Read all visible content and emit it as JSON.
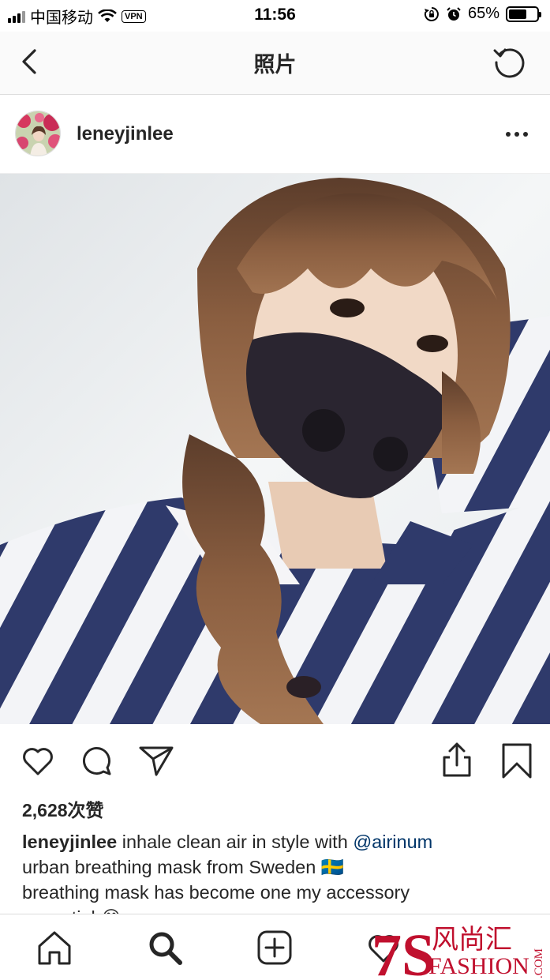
{
  "status_bar": {
    "carrier": "中国移动",
    "vpn": "VPN",
    "time": "11:56",
    "battery": "65%",
    "battery_level": 0.65
  },
  "nav": {
    "title": "照片",
    "back_icon": "chevron-left-icon",
    "refresh_icon": "refresh-icon"
  },
  "post": {
    "username": "leneyjinlee",
    "more_icon": "more-horizontal-icon",
    "likes": "2,628次赞",
    "caption": {
      "username": "leneyjinlee",
      "text_before_mention": " inhale clean air in style with ",
      "mention": "@airinum",
      "line2": "urban breathing mask from Sweden 🇸🇪",
      "line3": "breathing mask has become one my accessory",
      "line4": "essential 😂"
    }
  },
  "actions": [
    "heart-icon",
    "comment-icon",
    "share-direct-icon",
    "upload-icon",
    "bookmark-icon"
  ],
  "tabs": [
    "home-icon",
    "search-icon",
    "add-post-icon",
    "activity-heart-icon"
  ],
  "watermark": {
    "number": "7S",
    "cn": "风尚汇",
    "en": "FASHION",
    "domain": ".COM"
  },
  "colors": {
    "text": "#262626",
    "mention": "#003569",
    "divider": "#dbdbdb",
    "watermark": "#c0102e"
  }
}
